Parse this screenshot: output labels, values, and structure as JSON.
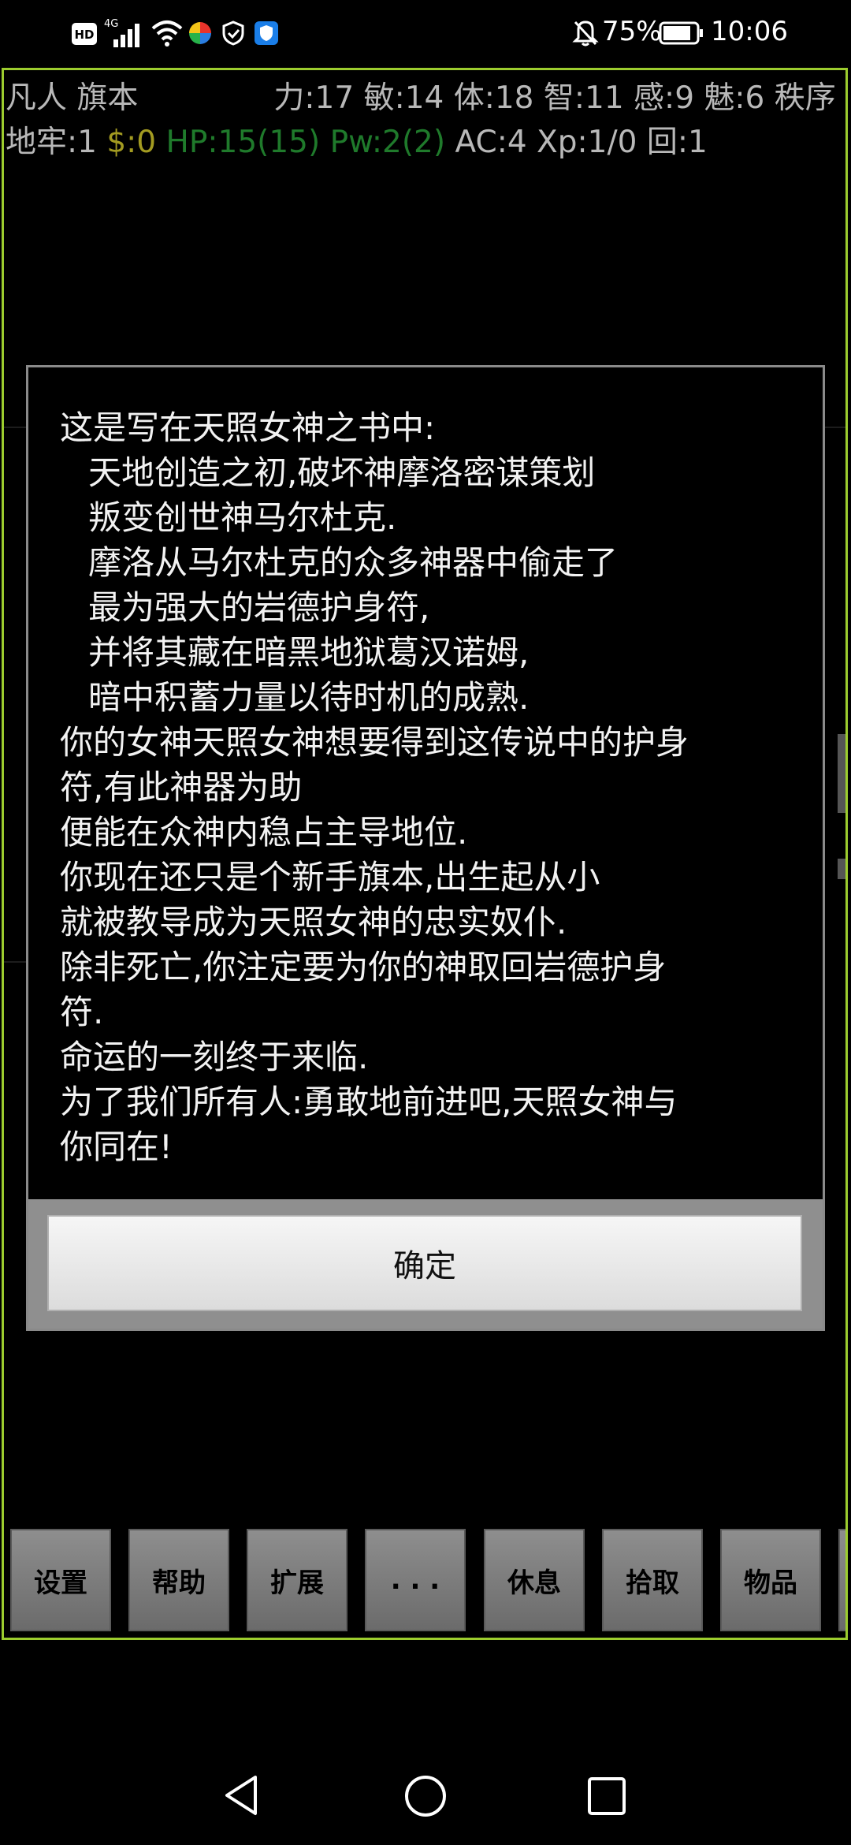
{
  "status_bar": {
    "battery_percent": "75%",
    "time": "10:06",
    "network_label": "4G",
    "hd_label": "HD"
  },
  "stats": {
    "line1_left": "凡人 旗本",
    "line1_right": "力:17 敏:14 体:18 智:11 感:9 魅:6 秩序",
    "dungeon": "地牢:1",
    "gold": "$:0",
    "hp_pw": "HP:15(15) Pw:2(2)",
    "rest": "AC:4 Xp:1/0 回:1"
  },
  "dialog": {
    "lines": [
      {
        "text": "这是写在天照女神之书中:",
        "indent": false
      },
      {
        "text": "天地创造之初,破坏神摩洛密谋策划",
        "indent": true
      },
      {
        "text": "叛变创世神马尔杜克.",
        "indent": true
      },
      {
        "text": "摩洛从马尔杜克的众多神器中偷走了",
        "indent": true
      },
      {
        "text": "最为强大的岩德护身符,",
        "indent": true
      },
      {
        "text": "并将其藏在暗黑地狱葛汉诺姆,",
        "indent": true
      },
      {
        "text": "暗中积蓄力量以待时机的成熟.",
        "indent": true
      },
      {
        "text": "你的女神天照女神想要得到这传说中的护身",
        "indent": false
      },
      {
        "text": "符,有此神器为助",
        "indent": false
      },
      {
        "text": "便能在众神内稳占主导地位.",
        "indent": false
      },
      {
        "text": "你现在还只是个新手旗本,出生起从小",
        "indent": false
      },
      {
        "text": "就被教导成为天照女神的忠实奴仆.",
        "indent": false
      },
      {
        "text": "除非死亡,你注定要为你的神取回岩德护身",
        "indent": false
      },
      {
        "text": "符.",
        "indent": false
      },
      {
        "text": "命运的一刻终于来临.",
        "indent": false
      },
      {
        "text": "为了我们所有人:勇敢地前进吧,天照女神与",
        "indent": false
      },
      {
        "text": "你同在!",
        "indent": false
      }
    ],
    "ok_label": "确定"
  },
  "toolbar": {
    "buttons": [
      "设置",
      "帮助",
      "扩展",
      ". . .",
      "休息",
      "拾取",
      "物品"
    ]
  },
  "colors": {
    "frame_border": "#9ccc2e",
    "gold": "#a39b21",
    "hp_green": "#1f7a2b",
    "stat_gray": "#b8b8b8"
  }
}
